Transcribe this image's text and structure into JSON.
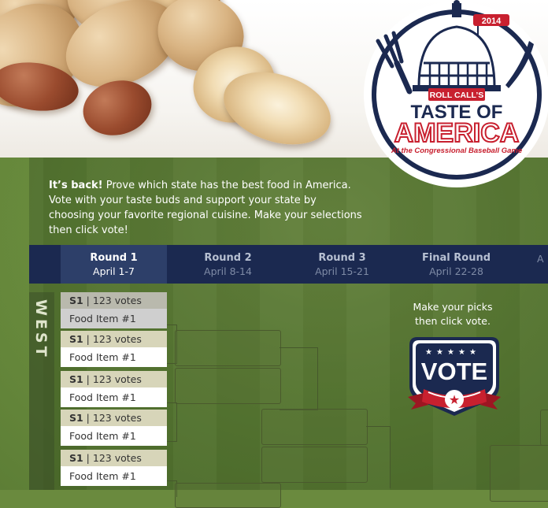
{
  "intro": {
    "lead": "It’s back!",
    "body": "Prove which state has the best food in America. Vote with your taste buds and support your state by choosing your favorite regional cuisine. Make your selections then click vote!"
  },
  "logo": {
    "year": "2014",
    "brand": "ROLL CALL’S",
    "line1": "TASTE OF",
    "line2": "AMERICA",
    "tagline": "At the Congressional Baseball Game"
  },
  "rounds": [
    {
      "name": "Round 1",
      "dates": "April 1-7",
      "active": true
    },
    {
      "name": "Round 2",
      "dates": "April 8-14",
      "active": false
    },
    {
      "name": "Round 3",
      "dates": "April 15-21",
      "active": false
    },
    {
      "name": "Final Round",
      "dates": "April 22-28",
      "active": false
    },
    {
      "name": "",
      "dates": "A",
      "active": false
    }
  ],
  "region": "WEST",
  "matchups": [
    {
      "seed": "S1",
      "votes": "123 votes",
      "item": "Food Item #1"
    },
    {
      "seed": "S1",
      "votes": "123 votes",
      "item": "Food Item #1"
    },
    {
      "seed": "S1",
      "votes": "123 votes",
      "item": "Food Item #1"
    },
    {
      "seed": "S1",
      "votes": "123 votes",
      "item": "Food Item #1"
    },
    {
      "seed": "S1",
      "votes": "123 votes",
      "item": "Food Item #1"
    }
  ],
  "vote_promo": {
    "line1": "Make your picks",
    "line2": "then click vote.",
    "button": "VOTE"
  },
  "colors": {
    "navy": "#1b2950",
    "active_tab": "#2d3f69",
    "red": "#c8202f",
    "field_green": "#668a38"
  }
}
